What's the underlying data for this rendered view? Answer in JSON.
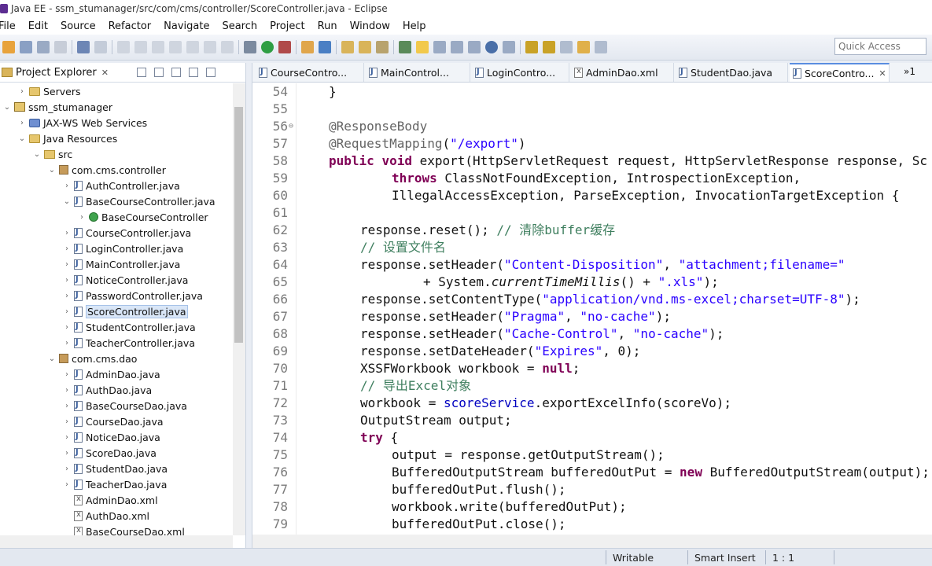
{
  "window": {
    "title": "Java EE - ssm_stumanager/src/com/cms/controller/ScoreController.java - Eclipse"
  },
  "menu": [
    "File",
    "Edit",
    "Source",
    "Refactor",
    "Navigate",
    "Search",
    "Project",
    "Run",
    "Window",
    "Help"
  ],
  "toolbar": {
    "quick_access_placeholder": "Quick Access"
  },
  "explorer": {
    "tab_title": "Project Explorer",
    "tree": [
      {
        "label": "Servers",
        "icon": "folder-icon",
        "depth": 1,
        "expanded": false
      },
      {
        "label": "ssm_stumanager",
        "icon": "project-icon",
        "depth": 0,
        "expanded": true
      },
      {
        "label": "JAX-WS Web Services",
        "icon": "web-services-icon",
        "depth": 1,
        "expanded": false
      },
      {
        "label": "Java Resources",
        "icon": "java-resources-icon",
        "depth": 1,
        "expanded": true
      },
      {
        "label": "src",
        "icon": "source-folder-icon",
        "depth": 2,
        "expanded": true
      },
      {
        "label": "com.cms.controller",
        "icon": "package-icon",
        "depth": 3,
        "expanded": true
      },
      {
        "label": "AuthController.java",
        "icon": "java-file-icon",
        "depth": 4,
        "expanded": false
      },
      {
        "label": "BaseCourseController.java",
        "icon": "java-file-icon",
        "depth": 4,
        "expanded": true
      },
      {
        "label": "BaseCourseController",
        "icon": "class-icon",
        "depth": 5,
        "expanded": false
      },
      {
        "label": "CourseController.java",
        "icon": "java-file-icon",
        "depth": 4,
        "expanded": false
      },
      {
        "label": "LoginController.java",
        "icon": "java-file-icon",
        "depth": 4,
        "expanded": false
      },
      {
        "label": "MainController.java",
        "icon": "java-file-icon",
        "depth": 4,
        "expanded": false
      },
      {
        "label": "NoticeController.java",
        "icon": "java-file-icon",
        "depth": 4,
        "expanded": false
      },
      {
        "label": "PasswordController.java",
        "icon": "java-file-icon",
        "depth": 4,
        "expanded": false
      },
      {
        "label": "ScoreController.java",
        "icon": "java-file-icon",
        "depth": 4,
        "expanded": false,
        "selected": true
      },
      {
        "label": "StudentController.java",
        "icon": "java-file-icon",
        "depth": 4,
        "expanded": false
      },
      {
        "label": "TeacherController.java",
        "icon": "java-file-icon",
        "depth": 4,
        "expanded": false
      },
      {
        "label": "com.cms.dao",
        "icon": "package-icon",
        "depth": 3,
        "expanded": true
      },
      {
        "label": "AdminDao.java",
        "icon": "java-file-icon",
        "depth": 4,
        "expanded": false
      },
      {
        "label": "AuthDao.java",
        "icon": "java-file-icon",
        "depth": 4,
        "expanded": false
      },
      {
        "label": "BaseCourseDao.java",
        "icon": "java-file-icon",
        "depth": 4,
        "expanded": false
      },
      {
        "label": "CourseDao.java",
        "icon": "java-file-icon",
        "depth": 4,
        "expanded": false
      },
      {
        "label": "NoticeDao.java",
        "icon": "java-file-icon",
        "depth": 4,
        "expanded": false
      },
      {
        "label": "ScoreDao.java",
        "icon": "java-file-icon",
        "depth": 4,
        "expanded": false
      },
      {
        "label": "StudentDao.java",
        "icon": "java-file-icon",
        "depth": 4,
        "expanded": false
      },
      {
        "label": "TeacherDao.java",
        "icon": "java-file-icon",
        "depth": 4,
        "expanded": false
      },
      {
        "label": "AdminDao.xml",
        "icon": "xml-file-icon",
        "depth": 4,
        "leaf": true
      },
      {
        "label": "AuthDao.xml",
        "icon": "xml-file-icon",
        "depth": 4,
        "leaf": true
      },
      {
        "label": "BaseCourseDao.xml",
        "icon": "xml-file-icon",
        "depth": 4,
        "leaf": true
      }
    ]
  },
  "editor": {
    "tabs": [
      {
        "label": "CourseContro...",
        "icon": "java-file-icon"
      },
      {
        "label": "MainControl...",
        "icon": "java-file-icon"
      },
      {
        "label": "LoginContro...",
        "icon": "java-file-icon"
      },
      {
        "label": "AdminDao.xml",
        "icon": "xml-file-icon"
      },
      {
        "label": "StudentDao.java",
        "icon": "java-file-icon"
      },
      {
        "label": "ScoreContro...",
        "icon": "java-file-icon",
        "active": true
      }
    ],
    "overflow_tabs": "»1",
    "lines": [
      {
        "n": "54",
        "indent": 0,
        "tokens": [
          [
            "t",
            "}"
          ]
        ]
      },
      {
        "n": "55",
        "indent": 0,
        "tokens": []
      },
      {
        "n": "56",
        "indent": 0,
        "fold": true,
        "tokens": [
          [
            "ann",
            "@ResponseBody"
          ]
        ]
      },
      {
        "n": "57",
        "indent": 0,
        "tokens": [
          [
            "ann",
            "@RequestMapping"
          ],
          [
            "t",
            "("
          ],
          [
            "str",
            "\"/export\""
          ],
          [
            "t",
            ")"
          ]
        ]
      },
      {
        "n": "58",
        "indent": 0,
        "tokens": [
          [
            "kw",
            "public"
          ],
          [
            "t",
            " "
          ],
          [
            "kw",
            "void"
          ],
          [
            "t",
            " export(HttpServletRequest request, HttpServletResponse response, Sc"
          ]
        ]
      },
      {
        "n": "59",
        "indent": 2,
        "tokens": [
          [
            "kw",
            "throws"
          ],
          [
            "t",
            " ClassNotFoundException, IntrospectionException,"
          ]
        ]
      },
      {
        "n": "60",
        "indent": 2,
        "tokens": [
          [
            "t",
            "IllegalAccessException, ParseException, InvocationTargetException {"
          ]
        ]
      },
      {
        "n": "61",
        "indent": 0,
        "tokens": []
      },
      {
        "n": "62",
        "indent": 1,
        "tokens": [
          [
            "t",
            "response.reset(); "
          ],
          [
            "cm",
            "// 清除buffer缓存"
          ]
        ]
      },
      {
        "n": "63",
        "indent": 1,
        "tokens": [
          [
            "cm",
            "// 设置文件名"
          ]
        ]
      },
      {
        "n": "64",
        "indent": 1,
        "tokens": [
          [
            "t",
            "response.setHeader("
          ],
          [
            "str",
            "\"Content-Disposition\""
          ],
          [
            "t",
            ", "
          ],
          [
            "str",
            "\"attachment;filename=\""
          ]
        ]
      },
      {
        "n": "65",
        "indent": 3,
        "tokens": [
          [
            "t",
            "+ System."
          ],
          [
            "it",
            "currentTimeMillis"
          ],
          [
            "t",
            "() + "
          ],
          [
            "str",
            "\".xls\""
          ],
          [
            "t",
            ");"
          ]
        ]
      },
      {
        "n": "66",
        "indent": 1,
        "tokens": [
          [
            "t",
            "response.setContentType("
          ],
          [
            "str",
            "\"application/vnd.ms-excel;charset=UTF-8\""
          ],
          [
            "t",
            ");"
          ]
        ]
      },
      {
        "n": "67",
        "indent": 1,
        "tokens": [
          [
            "t",
            "response.setHeader("
          ],
          [
            "str",
            "\"Pragma\""
          ],
          [
            "t",
            ", "
          ],
          [
            "str",
            "\"no-cache\""
          ],
          [
            "t",
            ");"
          ]
        ]
      },
      {
        "n": "68",
        "indent": 1,
        "tokens": [
          [
            "t",
            "response.setHeader("
          ],
          [
            "str",
            "\"Cache-Control\""
          ],
          [
            "t",
            ", "
          ],
          [
            "str",
            "\"no-cache\""
          ],
          [
            "t",
            ");"
          ]
        ]
      },
      {
        "n": "69",
        "indent": 1,
        "tokens": [
          [
            "t",
            "response.setDateHeader("
          ],
          [
            "str",
            "\"Expires\""
          ],
          [
            "t",
            ", 0);"
          ]
        ]
      },
      {
        "n": "70",
        "indent": 1,
        "tokens": [
          [
            "t",
            "XSSFWorkbook workbook = "
          ],
          [
            "kw",
            "null"
          ],
          [
            "t",
            ";"
          ]
        ]
      },
      {
        "n": "71",
        "indent": 1,
        "tokens": [
          [
            "cm",
            "// 导出Excel对象"
          ]
        ]
      },
      {
        "n": "72",
        "indent": 1,
        "tokens": [
          [
            "t",
            "workbook = "
          ],
          [
            "fld",
            "scoreService"
          ],
          [
            "t",
            ".exportExcelInfo(scoreVo);"
          ]
        ]
      },
      {
        "n": "73",
        "indent": 1,
        "tokens": [
          [
            "t",
            "OutputStream output;"
          ]
        ]
      },
      {
        "n": "74",
        "indent": 1,
        "tokens": [
          [
            "kw",
            "try"
          ],
          [
            "t",
            " {"
          ]
        ]
      },
      {
        "n": "75",
        "indent": 2,
        "tokens": [
          [
            "t",
            "output = response.getOutputStream();"
          ]
        ]
      },
      {
        "n": "76",
        "indent": 2,
        "tokens": [
          [
            "t",
            "BufferedOutputStream bufferedOutPut = "
          ],
          [
            "kw",
            "new"
          ],
          [
            "t",
            " BufferedOutputStream(output);"
          ]
        ]
      },
      {
        "n": "77",
        "indent": 2,
        "tokens": [
          [
            "t",
            "bufferedOutPut.flush();"
          ]
        ]
      },
      {
        "n": "78",
        "indent": 2,
        "tokens": [
          [
            "t",
            "workbook.write(bufferedOutPut);"
          ]
        ]
      },
      {
        "n": "79",
        "indent": 2,
        "tokens": [
          [
            "t",
            "bufferedOutPut.close();"
          ]
        ]
      }
    ]
  },
  "status": {
    "writable": "Writable",
    "insert_mode": "Smart Insert",
    "position": "1 : 1"
  },
  "colors": {
    "keyword": "#7f0055",
    "string": "#2a00ff",
    "comment": "#3f7f5f",
    "annotation": "#646464",
    "field": "#0000c0"
  }
}
